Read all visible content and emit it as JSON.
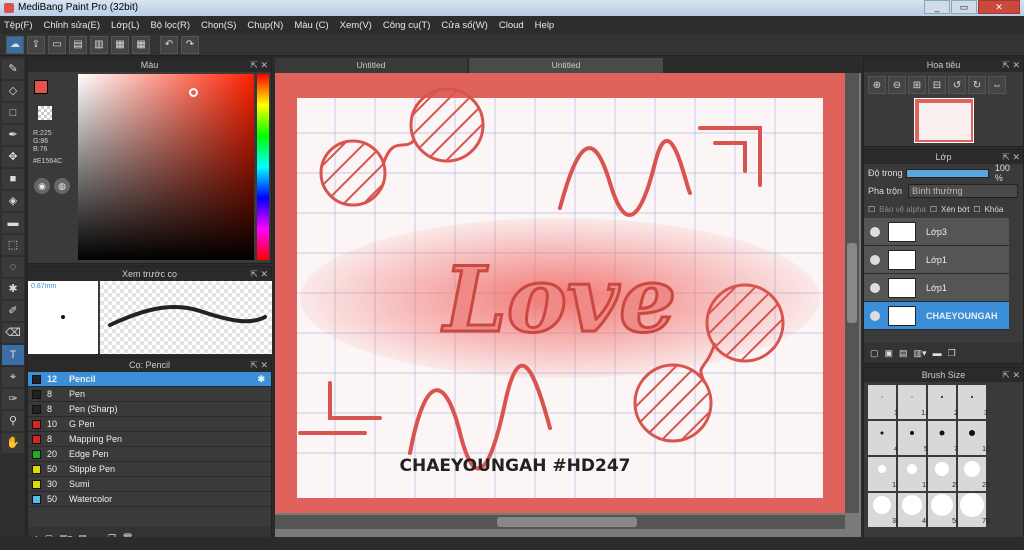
{
  "window": {
    "title": "MediBang Paint Pro (32bit)",
    "minimize": "_",
    "maximize": "▭",
    "close": "✕"
  },
  "menu": [
    "Tệp(F)",
    "Chỉnh sửa(E)",
    "Lớp(L)",
    "Bộ lọc(R)",
    "Chọn(S)",
    "Chụp(N)",
    "Màu (C)",
    "Xem(V)",
    "Công cụ(T)",
    "Cửa số(W)",
    "Cloud",
    "Help"
  ],
  "color_panel": {
    "title": "Màu",
    "r": "R:225",
    "g": "G:86",
    "b": "B:76",
    "hex": "#E1564C",
    "accent": "#E1564C"
  },
  "preview_panel": {
    "title": "Xem trước cọ",
    "size": "0.87mm"
  },
  "brush_panel": {
    "title": "Cọ: Pencil",
    "brushes": [
      {
        "size": "12",
        "name": "Pencil",
        "color": "#222222",
        "selected": true
      },
      {
        "size": "8",
        "name": "Pen",
        "color": "#222222"
      },
      {
        "size": "8",
        "name": "Pen (Sharp)",
        "color": "#222222"
      },
      {
        "size": "10",
        "name": "G Pen",
        "color": "#dd2222"
      },
      {
        "size": "8",
        "name": "Mapping Pen",
        "color": "#dd2222"
      },
      {
        "size": "20",
        "name": "Edge Pen",
        "color": "#22aa22"
      },
      {
        "size": "50",
        "name": "Stipple Pen",
        "color": "#dddd00"
      },
      {
        "size": "30",
        "name": "Sumi",
        "color": "#dddd00"
      },
      {
        "size": "50",
        "name": "Watercolor",
        "color": "#55bbee"
      }
    ]
  },
  "tabs": [
    "Untitled",
    "Untitled"
  ],
  "canvas": {
    "word": "Love",
    "signature": "CHAEYOUNGAH #HD247",
    "stroke_color": "#d9534f"
  },
  "navigator": {
    "title": "Hoa tiêu"
  },
  "layer_panel": {
    "title": "Lớp",
    "opacity_label": "Độ trong",
    "opacity_value": "100 %",
    "opacity_fraction": 1.0,
    "blend_label": "Pha trộn",
    "blend_value": "Bình thường",
    "protect_alpha": "Bảo vệ alpha",
    "clip": "Xén bớt",
    "lock": "Khóa",
    "layers": [
      {
        "name": "Lớp3",
        "selected": false
      },
      {
        "name": "Lớp1",
        "selected": false
      },
      {
        "name": "Lớp1",
        "selected": false
      },
      {
        "name": "CHAEYOUNGAH",
        "selected": true
      }
    ]
  },
  "brush_size_panel": {
    "title": "Brush Size",
    "sizes": [
      "1",
      "1.5",
      "2",
      "3",
      "4",
      "5",
      "7",
      "10",
      "12",
      "15",
      "20",
      "25",
      "30",
      "40",
      "50",
      "70"
    ]
  }
}
